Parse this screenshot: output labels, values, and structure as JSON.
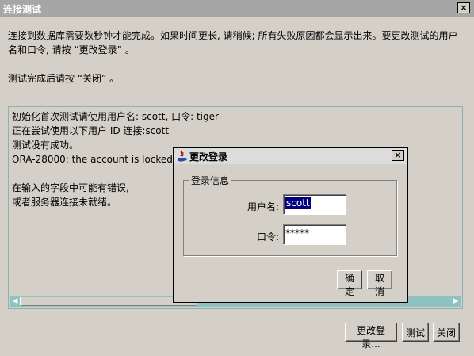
{
  "window": {
    "title": "连接测试",
    "close": "×"
  },
  "description": {
    "line1": "连接到数据库需要数秒钟才能完成。如果时间更长, 请稍候; 所有失败原因都会显示出来。要更改测试的用户",
    "line2": "名和口令, 请按 “更改登录” 。",
    "line3": "测试完成后请按 “关闭” 。"
  },
  "results": [
    "初始化首次测试请使用用户名: scott, 口令: tiger",
    "正在尝试使用以下用户 ID 连接:scott",
    "测试没有成功。",
    "ORA-28000: the account is locked",
    "",
    "在输入的字段中可能有错误,",
    "或者服务器连接未就绪。"
  ],
  "buttons": {
    "change_login": "更改登录...",
    "test": "测试",
    "close": "关闭"
  },
  "dialog": {
    "title": "更改登录",
    "close": "×",
    "group_title": "登录信息",
    "username_label": "用户名:",
    "username_value": "scott",
    "password_label": "口令:",
    "password_value": "*****",
    "ok": "确定",
    "cancel": "取消"
  },
  "colors": {
    "title_bar": "#a6a6a6",
    "scroll_track": "#8ec3c3",
    "selection": "#000080"
  },
  "icons": {
    "dialog_icon": "java-icon"
  }
}
